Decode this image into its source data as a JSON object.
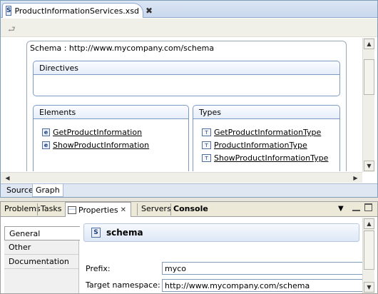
{
  "editor": {
    "tab_title": "ProductInformationServices.xsd",
    "tab_icon": "xsd-file-icon",
    "close_glyph": "✖",
    "schema": {
      "title": "Schema : http://www.mycompany.com/schema",
      "sections": {
        "directives": {
          "label": "Directives",
          "items": []
        },
        "elements": {
          "label": "Elements",
          "items": [
            {
              "label": "GetProductInformation",
              "icon": "element-icon",
              "icon_glyph": "e"
            },
            {
              "label": "ShowProductInformation",
              "icon": "element-icon",
              "icon_glyph": "e"
            }
          ]
        },
        "types": {
          "label": "Types",
          "items": [
            {
              "label": "GetProductInformationType",
              "icon": "complex-type-icon",
              "icon_glyph": "T"
            },
            {
              "label": "ProductInformationType",
              "icon": "complex-type-icon",
              "icon_glyph": "T"
            },
            {
              "label": "ShowProductInformationType",
              "icon": "complex-type-icon",
              "icon_glyph": "T"
            }
          ]
        }
      }
    },
    "bottom_tabs": [
      "Source",
      "Graph"
    ],
    "active_bottom_tab": "Graph"
  },
  "properties_view": {
    "tabs": [
      "Problems",
      "Tasks",
      "Properties",
      "Servers",
      "Console"
    ],
    "active_tab": "Properties",
    "sidebar": [
      "General",
      "Other",
      "Documentation"
    ],
    "active_sidebar": "General",
    "header": {
      "title": "schema",
      "icon": "schema-icon",
      "icon_glyph": "S"
    },
    "fields": [
      {
        "label": "Prefix:",
        "value": "myco"
      },
      {
        "label": "Target namespace:",
        "value": "http://www.mycompany.com/schema"
      }
    ]
  }
}
